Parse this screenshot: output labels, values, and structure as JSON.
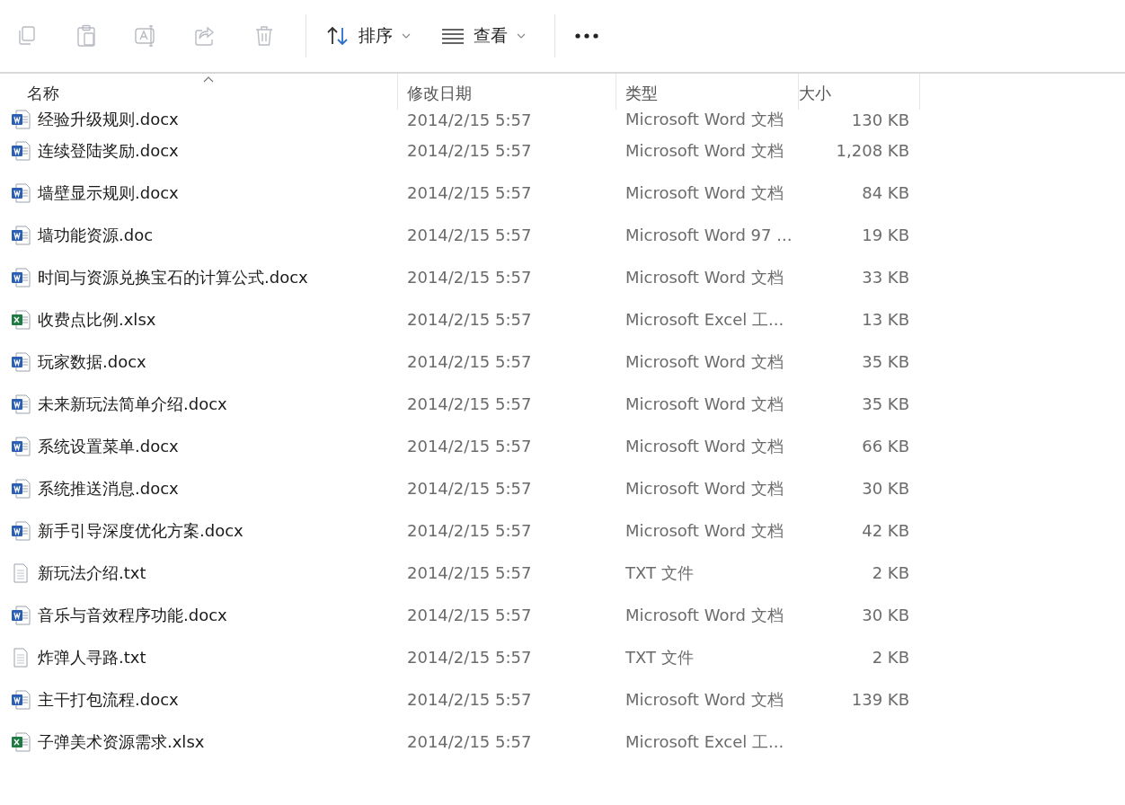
{
  "toolbar": {
    "actions": [
      {
        "kind": "copy",
        "disabled": true
      },
      {
        "kind": "paste",
        "disabled": true
      },
      {
        "kind": "rename",
        "disabled": true
      },
      {
        "kind": "share",
        "disabled": true
      },
      {
        "kind": "delete",
        "disabled": true
      }
    ],
    "sort": {
      "label": "排序"
    },
    "view": {
      "label": "查看"
    }
  },
  "table": {
    "columns": [
      {
        "label": "名称",
        "sorted": true
      },
      {
        "label": "修改日期",
        "sorted": false
      },
      {
        "label": "类型",
        "sorted": false
      },
      {
        "label": "大小",
        "sorted": false
      }
    ],
    "rows": [
      {
        "kind": "word",
        "name": "经验升级规则.docx",
        "date": "2014/2/15 5:57",
        "type": "Microsoft Word 文档",
        "size": "130 KB"
      },
      {
        "kind": "word",
        "name": "连续登陆奖励.docx",
        "date": "2014/2/15 5:57",
        "type": "Microsoft Word 文档",
        "size": "1,208 KB"
      },
      {
        "kind": "word",
        "name": "墙壁显示规则.docx",
        "date": "2014/2/15 5:57",
        "type": "Microsoft Word 文档",
        "size": "84 KB"
      },
      {
        "kind": "word",
        "name": "墙功能资源.doc",
        "date": "2014/2/15 5:57",
        "type": "Microsoft Word 97 ...",
        "size": "19 KB"
      },
      {
        "kind": "word",
        "name": "时间与资源兑换宝石的计算公式.docx",
        "date": "2014/2/15 5:57",
        "type": "Microsoft Word 文档",
        "size": "33 KB"
      },
      {
        "kind": "excel",
        "name": "收费点比例.xlsx",
        "date": "2014/2/15 5:57",
        "type": "Microsoft Excel 工...",
        "size": "13 KB"
      },
      {
        "kind": "word",
        "name": "玩家数据.docx",
        "date": "2014/2/15 5:57",
        "type": "Microsoft Word 文档",
        "size": "35 KB"
      },
      {
        "kind": "word",
        "name": "未来新玩法简单介绍.docx",
        "date": "2014/2/15 5:57",
        "type": "Microsoft Word 文档",
        "size": "35 KB"
      },
      {
        "kind": "word",
        "name": "系统设置菜单.docx",
        "date": "2014/2/15 5:57",
        "type": "Microsoft Word 文档",
        "size": "66 KB"
      },
      {
        "kind": "word",
        "name": "系统推送消息.docx",
        "date": "2014/2/15 5:57",
        "type": "Microsoft Word 文档",
        "size": "30 KB"
      },
      {
        "kind": "word",
        "name": "新手引导深度优化方案.docx",
        "date": "2014/2/15 5:57",
        "type": "Microsoft Word 文档",
        "size": "42 KB"
      },
      {
        "kind": "txt",
        "name": "新玩法介绍.txt",
        "date": "2014/2/15 5:57",
        "type": "TXT 文件",
        "size": "2 KB"
      },
      {
        "kind": "word",
        "name": "音乐与音效程序功能.docx",
        "date": "2014/2/15 5:57",
        "type": "Microsoft Word 文档",
        "size": "30 KB"
      },
      {
        "kind": "txt",
        "name": "炸弹人寻路.txt",
        "date": "2014/2/15 5:57",
        "type": "TXT 文件",
        "size": "2 KB"
      },
      {
        "kind": "word",
        "name": "主干打包流程.docx",
        "date": "2014/2/15 5:57",
        "type": "Microsoft Word 文档",
        "size": "139 KB"
      },
      {
        "kind": "excel",
        "name": "子弹美术资源需求.xlsx",
        "date": "2014/2/15 5:57",
        "type": "Microsoft Excel 工..."
      }
    ]
  }
}
